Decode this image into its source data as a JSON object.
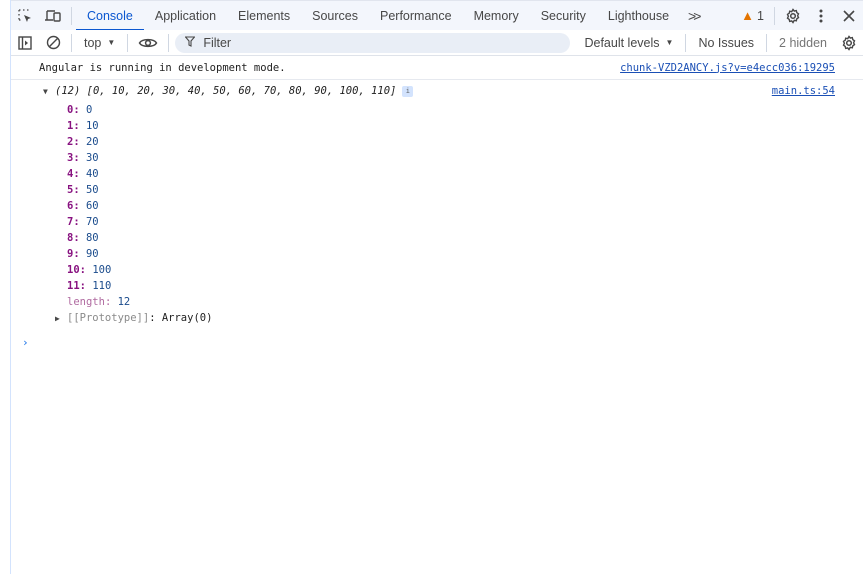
{
  "tabbar": {
    "tabs": [
      {
        "label": "Console",
        "active": true
      },
      {
        "label": "Application"
      },
      {
        "label": "Elements"
      },
      {
        "label": "Sources"
      },
      {
        "label": "Performance"
      },
      {
        "label": "Memory"
      },
      {
        "label": "Security"
      },
      {
        "label": "Lighthouse"
      }
    ],
    "more_label": ">>",
    "warning_count": "1"
  },
  "toolbar": {
    "context": "top",
    "filter_placeholder": "Filter",
    "levels": "Default levels",
    "issues": "No Issues",
    "hidden": "2 hidden"
  },
  "console": {
    "messages": [
      {
        "text": "Angular is running in development mode.",
        "source": "chunk-VZD2ANCY.js?v=e4ecc036:19295"
      }
    ],
    "array_log": {
      "count": "(12)",
      "summary": "[0, 10, 20, 30, 40, 50, 60, 70, 80, 90, 100, 110]",
      "source": "main.ts:54",
      "entries": [
        {
          "key": "0",
          "value": "0"
        },
        {
          "key": "1",
          "value": "10"
        },
        {
          "key": "2",
          "value": "20"
        },
        {
          "key": "3",
          "value": "30"
        },
        {
          "key": "4",
          "value": "40"
        },
        {
          "key": "5",
          "value": "50"
        },
        {
          "key": "6",
          "value": "60"
        },
        {
          "key": "7",
          "value": "70"
        },
        {
          "key": "8",
          "value": "80"
        },
        {
          "key": "9",
          "value": "90"
        },
        {
          "key": "10",
          "value": "100"
        },
        {
          "key": "11",
          "value": "110"
        }
      ],
      "length_key": "length",
      "length_value": "12",
      "prototype_key": "[[Prototype]]",
      "prototype_value": "Array(0)"
    },
    "prompt_symbol": "›"
  },
  "colors": {
    "accent": "#0b57d0",
    "warning": "#e37400",
    "key": "#881280",
    "value": "#1a4b8c"
  }
}
